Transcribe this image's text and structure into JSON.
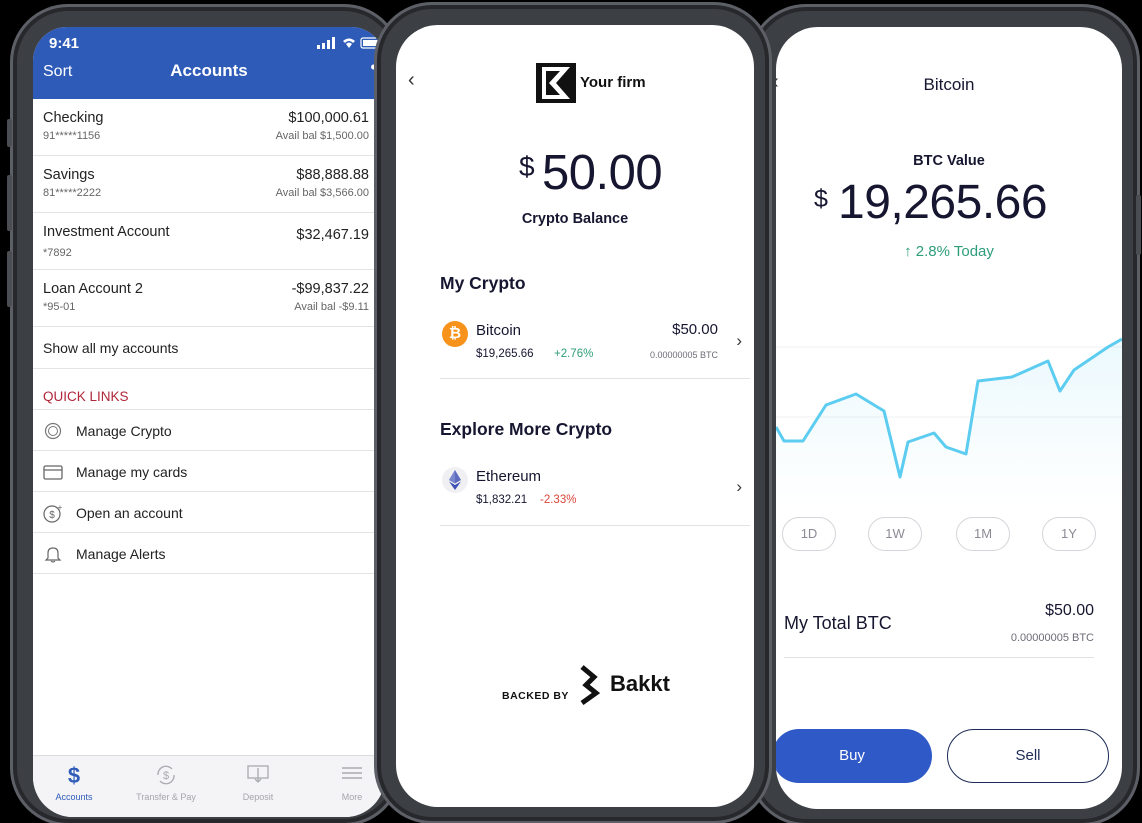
{
  "phone1": {
    "status_time": "9:41",
    "header": {
      "sort_label": "Sort",
      "title": "Accounts",
      "more_label": "••"
    },
    "accounts": [
      {
        "name": "Checking",
        "number": "91*****1156",
        "amount": "$100,000.61",
        "available": "Avail bal $1,500.00"
      },
      {
        "name": "Savings",
        "number": "81*****2222",
        "amount": "$88,888.88",
        "available": "Avail bal $3,566.00"
      },
      {
        "name": "Investment Account",
        "number": "*7892",
        "amount": "$32,467.19",
        "available": ""
      },
      {
        "name": "Loan Account 2",
        "number": "*95-01",
        "amount": "-$99,837.22",
        "available": "Avail bal -$9.11"
      }
    ],
    "show_all": "Show all my accounts",
    "quick_links_title": "QUICK LINKS",
    "quick_links": [
      {
        "label": "Manage Crypto",
        "icon": "crypto-coin-icon"
      },
      {
        "label": "Manage my cards",
        "icon": "card-icon"
      },
      {
        "label": "Open an account",
        "icon": "dollar-plus-icon"
      },
      {
        "label": "Manage Alerts",
        "icon": "bell-icon"
      }
    ],
    "tabs": [
      {
        "label": "Accounts",
        "icon": "dollar-icon",
        "active": true
      },
      {
        "label": "Transfer & Pay",
        "icon": "transfer-icon",
        "active": false
      },
      {
        "label": "Deposit",
        "icon": "deposit-icon",
        "active": false
      },
      {
        "label": "More",
        "icon": "menu-icon",
        "active": false
      }
    ],
    "brand_color": "#2e5bb8"
  },
  "phone2": {
    "firm_name": "Your firm",
    "balance_symbol": "$",
    "balance": "50.00",
    "balance_label": "Crypto Balance",
    "my_crypto_title": "My Crypto",
    "my_crypto": [
      {
        "name": "Bitcoin",
        "price": "$19,265.66",
        "change": "+2.76%",
        "value": "$50.00",
        "amount": "0.00000005 BTC",
        "icon": "bitcoin-icon"
      }
    ],
    "explore_title": "Explore More Crypto",
    "explore": [
      {
        "name": "Ethereum",
        "price": "$1,832.21",
        "change": "-2.33%",
        "icon": "ethereum-icon"
      }
    ],
    "backed_by": "BACKED BY",
    "partner": "Bakkt",
    "partner_tm": ".",
    "colors": {
      "positive": "#2e9d7a",
      "negative": "#d9453b"
    }
  },
  "phone3": {
    "title": "Bitcoin",
    "value_label": "BTC Value",
    "value_symbol": "$",
    "value": "19,265.66",
    "change": "↑ 2.8% Today",
    "chart_color": "#5ccdf0",
    "ranges": [
      "1D",
      "1W",
      "1M",
      "1Y"
    ],
    "total_label": "My Total BTC",
    "total_value": "$50.00",
    "total_btc": "0.00000005 BTC",
    "buy_label": "Buy",
    "sell_label": "Sell"
  }
}
